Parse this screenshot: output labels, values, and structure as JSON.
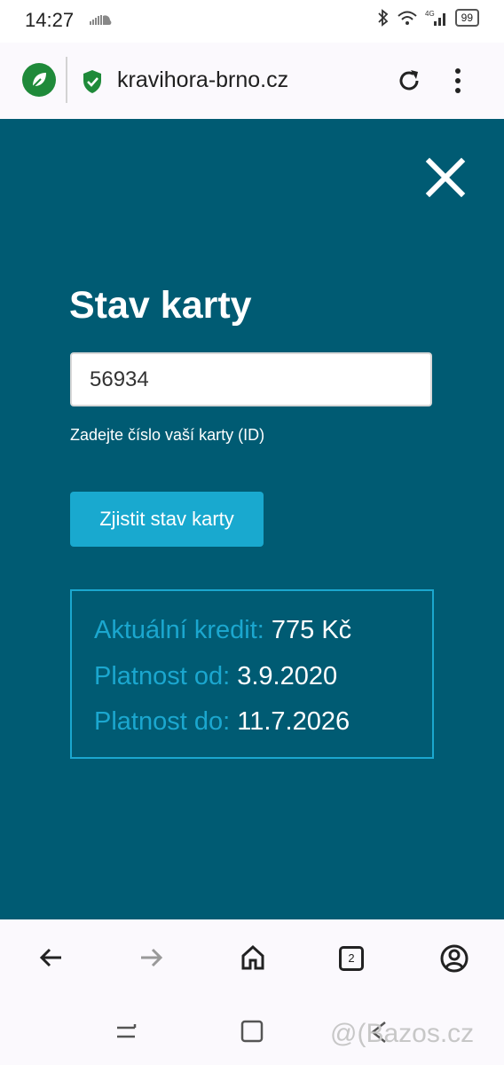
{
  "status_bar": {
    "time": "14:27",
    "battery": "99",
    "network": "4G"
  },
  "browser": {
    "url": "kravihora-brno.cz",
    "tab_count": "2"
  },
  "modal": {
    "title": "Stav karty",
    "card_input": {
      "value": "56934",
      "placeholder": ""
    },
    "helper_text": "Zadejte číslo vaší karty (ID)",
    "submit_label": "Zjistit stav karty",
    "results": [
      {
        "label": "Aktuální kredit:",
        "value": "775 Kč"
      },
      {
        "label": "Platnost od:",
        "value": "3.9.2020"
      },
      {
        "label": "Platnost do:",
        "value": "11.7.2026"
      }
    ]
  },
  "watermark": "@(Bazos.cz",
  "colors": {
    "panel": "#005b73",
    "accent": "#1ba7cf",
    "button": "#19a9cf"
  },
  "icons": [
    "soundcloud-icon",
    "bluetooth-icon",
    "wifi-icon",
    "signal-icon",
    "leaf-icon",
    "shield-check-icon",
    "reload-icon",
    "more-vert-icon",
    "close-icon",
    "back-arrow-icon",
    "forward-arrow-icon",
    "home-icon",
    "tabs-icon",
    "account-icon",
    "recents-icon",
    "overview-icon",
    "system-back-icon"
  ]
}
